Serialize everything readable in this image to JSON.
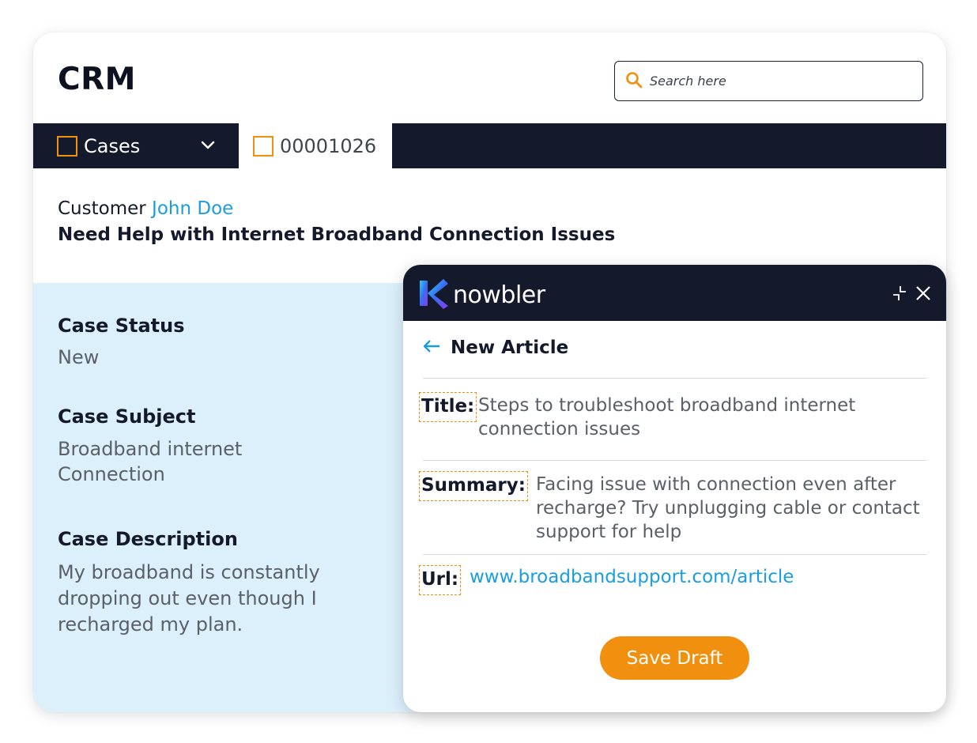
{
  "app": {
    "title": "CRM"
  },
  "search": {
    "placeholder": "Search here"
  },
  "tabs": {
    "cases_label": "Cases",
    "case_id_label": "00001026"
  },
  "case_header": {
    "customer_prefix": "Customer",
    "customer_name": "John Doe",
    "headline": "Need Help with Internet Broadband Connection Issues"
  },
  "case_fields": {
    "status_label": "Case Status",
    "status_value": "New",
    "subject_label": "Case Subject",
    "subject_value": "Broadband internet\nConnection",
    "description_label": "Case Description",
    "description_value": "My broadband is constantly\ndropping out even though I\nrecharged my plan."
  },
  "widget": {
    "brand": "nowbler",
    "heading": "New Article",
    "title_label": "Title:",
    "title_value": "Steps to troubleshoot broadband internet connection issues",
    "summary_label": "Summary:",
    "summary_value": "Facing issue with connection even after recharge? Try unplugging cable or contact support for help",
    "url_label": "Url:",
    "url_value": "www.broadbandsupport.com/article",
    "save_label": "Save Draft"
  },
  "colors": {
    "accent": "#f0900e",
    "link": "#1a9de0",
    "dark": "#141a2b",
    "panel": "#dcf0fb"
  },
  "icons": [
    "search-icon",
    "chevron-down-icon",
    "back-arrow-icon",
    "minimize-icon",
    "close-icon",
    "nowbler-logo-icon"
  ]
}
